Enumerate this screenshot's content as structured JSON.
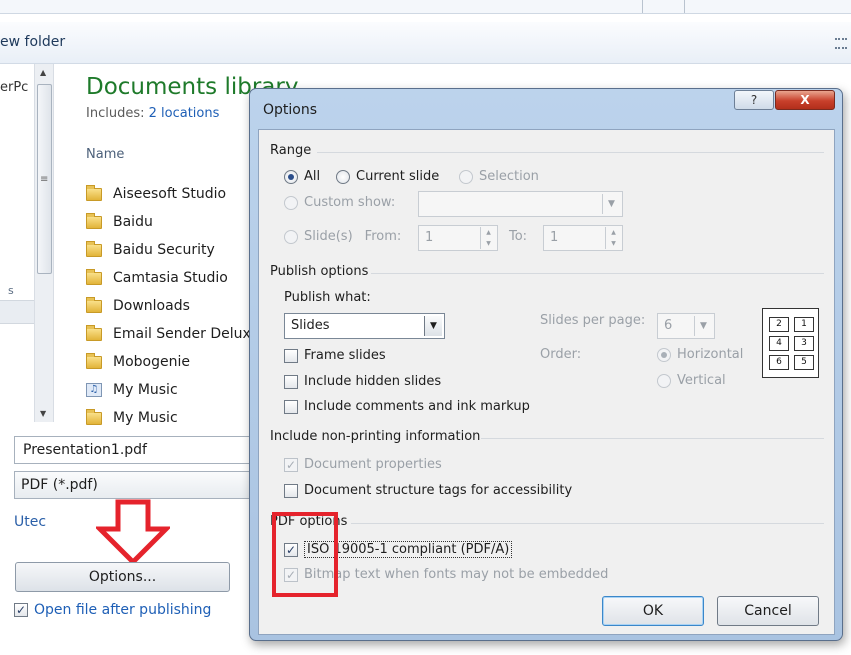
{
  "background": {
    "toolbar": {
      "new_folder": "ew folder"
    },
    "nav": {
      "item_partial": "erPc",
      "item_partial_2": "s"
    },
    "library": {
      "title": "Documents library",
      "includes_label": "Includes: ",
      "includes_link": "2 locations",
      "column_name": "Name",
      "items": [
        {
          "name": "Aiseesoft Studio",
          "icon": "folder-icon"
        },
        {
          "name": "Baidu",
          "icon": "folder-icon"
        },
        {
          "name": "Baidu Security",
          "icon": "folder-icon"
        },
        {
          "name": "Camtasia Studio",
          "icon": "folder-icon"
        },
        {
          "name": "Downloads",
          "icon": "folder-icon"
        },
        {
          "name": "Email Sender Deluxe",
          "icon": "folder-icon"
        },
        {
          "name": "Mobogenie",
          "icon": "folder-icon"
        },
        {
          "name": "My Music",
          "icon": "music-icon"
        },
        {
          "name": "My Music",
          "icon": "folder-icon"
        }
      ]
    },
    "file_name": "Presentation1.pdf",
    "file_type": "PDF (*.pdf)",
    "utec": "Utec",
    "options_button": "Options...",
    "open_after_publishing": "Open file after publishing",
    "open_after_checked": true
  },
  "dialog": {
    "title": "Options",
    "help_label": "?",
    "close_label": "X",
    "range": {
      "group_label": "Range",
      "all_label": "All",
      "current_slide_label": "Current slide",
      "selection_label": "Selection",
      "custom_show_label": "Custom show:",
      "slides_label": "Slide(s)",
      "from_label": "From:",
      "from_value": "1",
      "to_label": "To:",
      "to_value": "1",
      "selected": "All"
    },
    "publish": {
      "group_label": "Publish options",
      "publish_what_label": "Publish what:",
      "publish_what_value": "Slides",
      "slides_per_page_label": "Slides per page:",
      "slides_per_page_value": "6",
      "order_label": "Order:",
      "horizontal_label": "Horizontal",
      "vertical_label": "Vertical",
      "frame_slides_label": "Frame slides",
      "include_hidden_label": "Include hidden slides",
      "include_comments_label": "Include comments and ink markup",
      "order_cells": [
        "2",
        "1",
        "4",
        "3",
        "6",
        "5"
      ]
    },
    "non_printing": {
      "group_label": "Include non-printing information",
      "document_properties_label": "Document properties",
      "document_structure_label": "Document structure tags for accessibility"
    },
    "pdf": {
      "group_label": "PDF options",
      "iso_label": "ISO 19005-1 compliant (PDF/A)",
      "bitmap_label": "Bitmap text when fonts may not be embedded"
    },
    "ok_label": "OK",
    "cancel_label": "Cancel"
  },
  "colors": {
    "library_title": "#1e7a2a",
    "link": "#1e5fb6",
    "highlight": "#e5232c",
    "dialog_frame": "#bcd3ec"
  }
}
